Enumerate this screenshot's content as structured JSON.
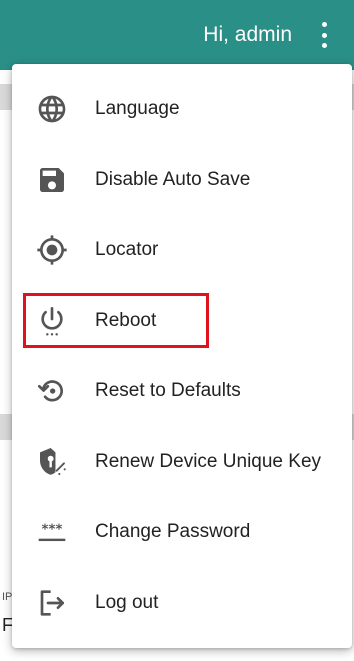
{
  "header": {
    "greeting": "Hi, admin",
    "menu_icon": "more-vert-icon",
    "color": "#2a8f86"
  },
  "menu": {
    "items": [
      {
        "label": "Language",
        "icon": "globe-icon"
      },
      {
        "label": "Disable Auto Save",
        "icon": "save-icon"
      },
      {
        "label": "Locator",
        "icon": "locator-icon"
      },
      {
        "label": "Reboot",
        "icon": "power-icon",
        "highlighted": true
      },
      {
        "label": "Reset to Defaults",
        "icon": "reset-icon"
      },
      {
        "label": "Renew Device Unique Key",
        "icon": "shield-key-icon"
      },
      {
        "label": "Change Password",
        "icon": "password-icon"
      },
      {
        "label": "Log out",
        "icon": "logout-icon"
      }
    ],
    "highlight_color": "#e0121c"
  },
  "background": {
    "peek_small": "IP",
    "peek_large": "F"
  }
}
